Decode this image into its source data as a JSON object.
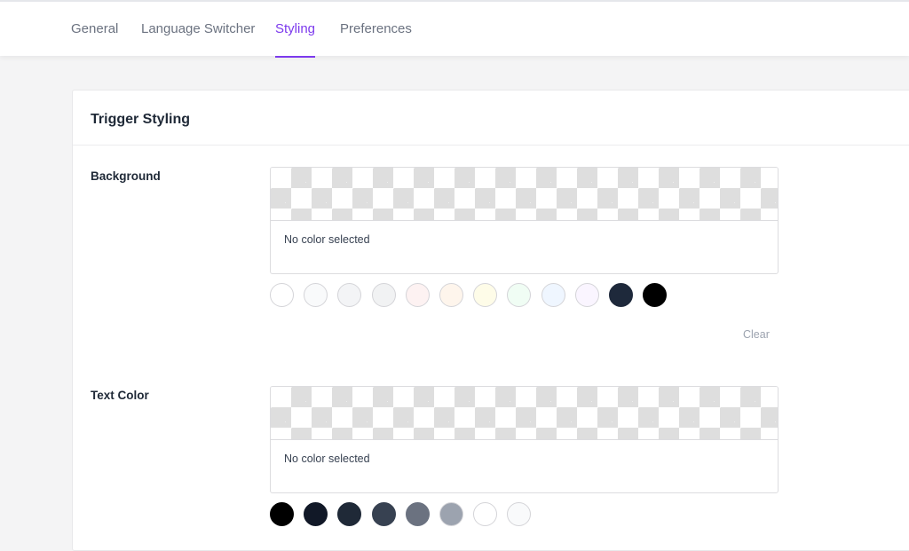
{
  "tabs": [
    {
      "label": "General"
    },
    {
      "label": "Language Switcher"
    },
    {
      "label": "Styling",
      "active": true
    },
    {
      "label": "Preferences"
    }
  ],
  "accent_color": "#7c3aed",
  "card": {
    "title": "Trigger Styling"
  },
  "background": {
    "label": "Background",
    "status": "No color selected",
    "clear_label": "Clear",
    "swatches": [
      "#ffffff",
      "#f9fafb",
      "#f3f4f6",
      "#f1f2f3",
      "#fdf2f2",
      "#fef5ec",
      "#fefce8",
      "#f0fdf4",
      "#eff6ff",
      "#faf5ff",
      "#1e293b",
      "#000000"
    ]
  },
  "text_color": {
    "label": "Text Color",
    "status": "No color selected",
    "swatches": [
      "#000000",
      "#111827",
      "#1f2937",
      "#374151",
      "#6b7280",
      "#9ca3af",
      "#ffffff",
      "#f9fafb"
    ]
  }
}
